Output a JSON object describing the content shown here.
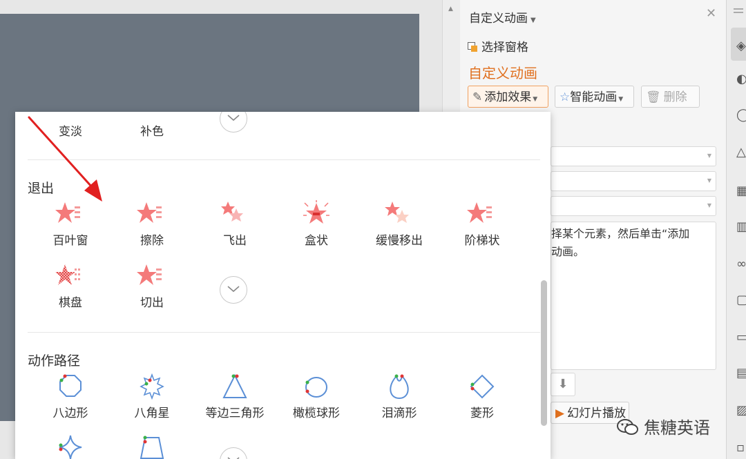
{
  "panel": {
    "title": "自定义动画",
    "select_pane": "选择窗格",
    "section_heading": "自定义动画",
    "add_effect": "添加效果",
    "smart_animation": "智能动画",
    "delete": "删除",
    "help_line1": "择某个元素，然后单击“添加",
    "help_line2": "动画。",
    "slideshow": "幻灯片播放",
    "accent_color": "#e0701f"
  },
  "popup": {
    "top_row": [
      "变淡",
      "补色"
    ],
    "exit": {
      "title": "退出",
      "items": [
        "百叶窗",
        "擦除",
        "飞出",
        "盒状",
        "缓慢移出",
        "阶梯状",
        "棋盘",
        "切出"
      ]
    },
    "path": {
      "title": "动作路径",
      "items": [
        "八边形",
        "八角星",
        "等边三角形",
        "橄榄球形",
        "泪滴形",
        "菱形"
      ]
    }
  },
  "watermark": "焦糖英语",
  "icons": {
    "close": "close-icon",
    "more": "chevron-down-icon",
    "star": "star-icon",
    "arrow": "red-annotation-arrow"
  },
  "colors": {
    "star": "#f47a7a",
    "path_line": "#5b8fd6",
    "annotation": "#e12020",
    "slide": "#6b7580"
  }
}
